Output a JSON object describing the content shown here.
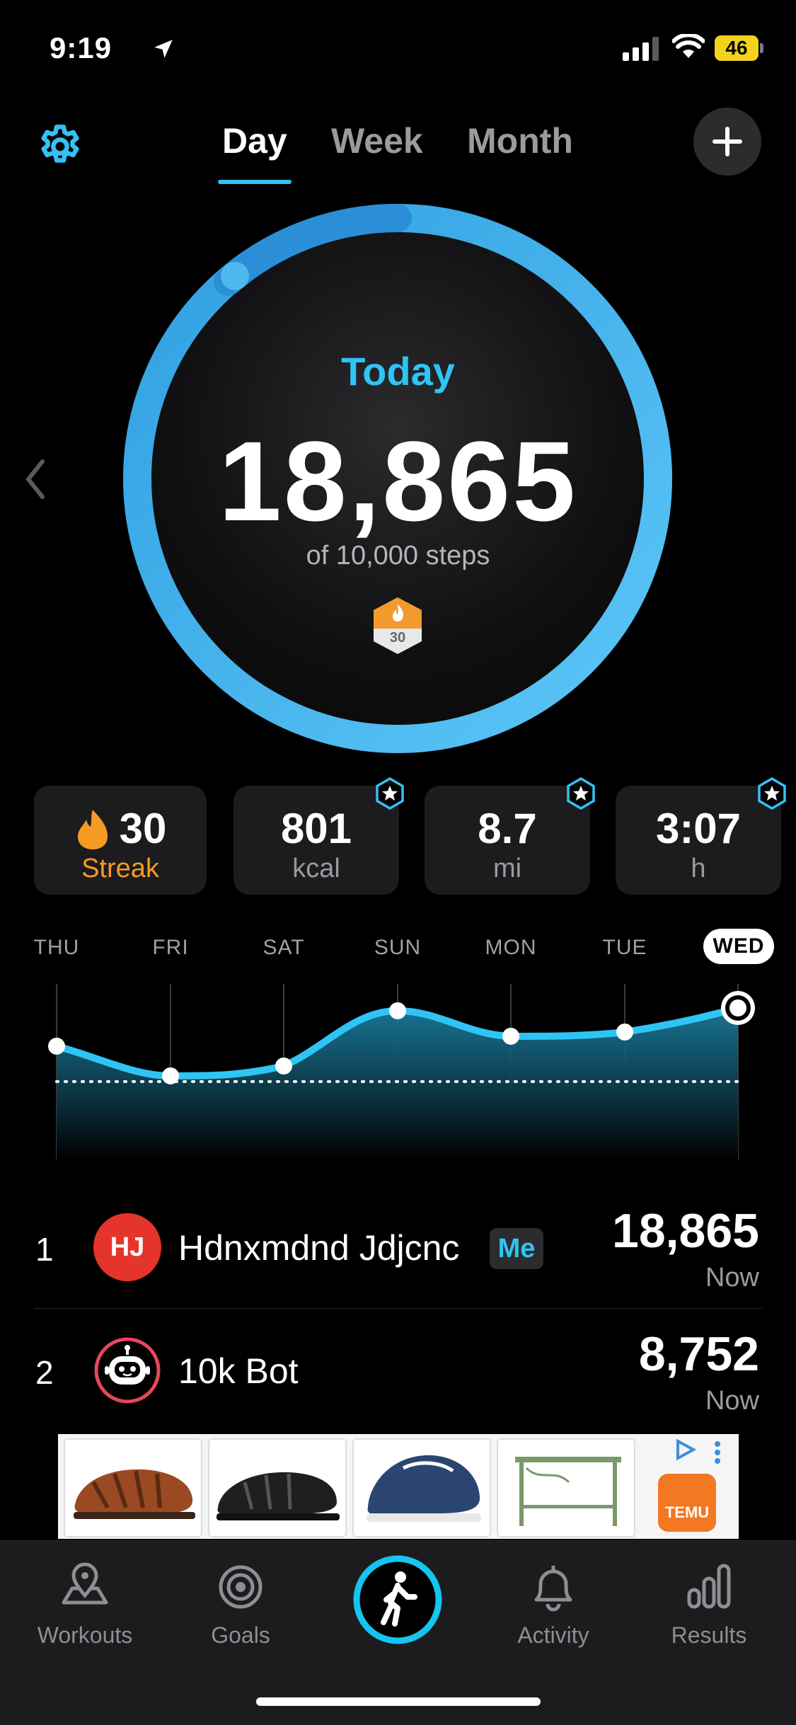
{
  "status_bar": {
    "time": "9:19",
    "battery": "46"
  },
  "header": {
    "tabs": [
      {
        "label": "Day",
        "active": true
      },
      {
        "label": "Week",
        "active": false
      },
      {
        "label": "Month",
        "active": false
      }
    ],
    "accent_color": "#36c0f5"
  },
  "ring": {
    "title": "Today",
    "steps": "18,865",
    "goal_text": "of 10,000 steps",
    "badge_number": "30",
    "progress_fraction": 1.0
  },
  "stats": [
    {
      "value": "30",
      "label": "Streak",
      "starred": false
    },
    {
      "value": "801",
      "label": "kcal",
      "starred": true
    },
    {
      "value": "8.7",
      "label": "mi",
      "starred": true
    },
    {
      "value": "3:07",
      "label": "h",
      "starred": true
    }
  ],
  "week_chart": {
    "days": [
      "THU",
      "FRI",
      "SAT",
      "SUN",
      "MON",
      "TUE",
      "WED"
    ],
    "selected_day": "WED"
  },
  "leaderboard": [
    {
      "rank": "1",
      "initials": "HJ",
      "name": "Hdnxmdnd Jdjcnc",
      "tag": "Me",
      "steps": "18,865",
      "time": "Now"
    },
    {
      "rank": "2",
      "initials": "",
      "name": "10k Bot",
      "tag": "",
      "steps": "8,752",
      "time": "Now"
    }
  ],
  "ad": {
    "brand": "TEMU"
  },
  "tabbar": [
    {
      "label": "Workouts",
      "icon": "map-pin-icon"
    },
    {
      "label": "Goals",
      "icon": "target-icon"
    },
    {
      "label": "",
      "icon": "walking-icon"
    },
    {
      "label": "Activity",
      "icon": "bell-icon"
    },
    {
      "label": "Results",
      "icon": "bar-chart-icon"
    }
  ]
}
